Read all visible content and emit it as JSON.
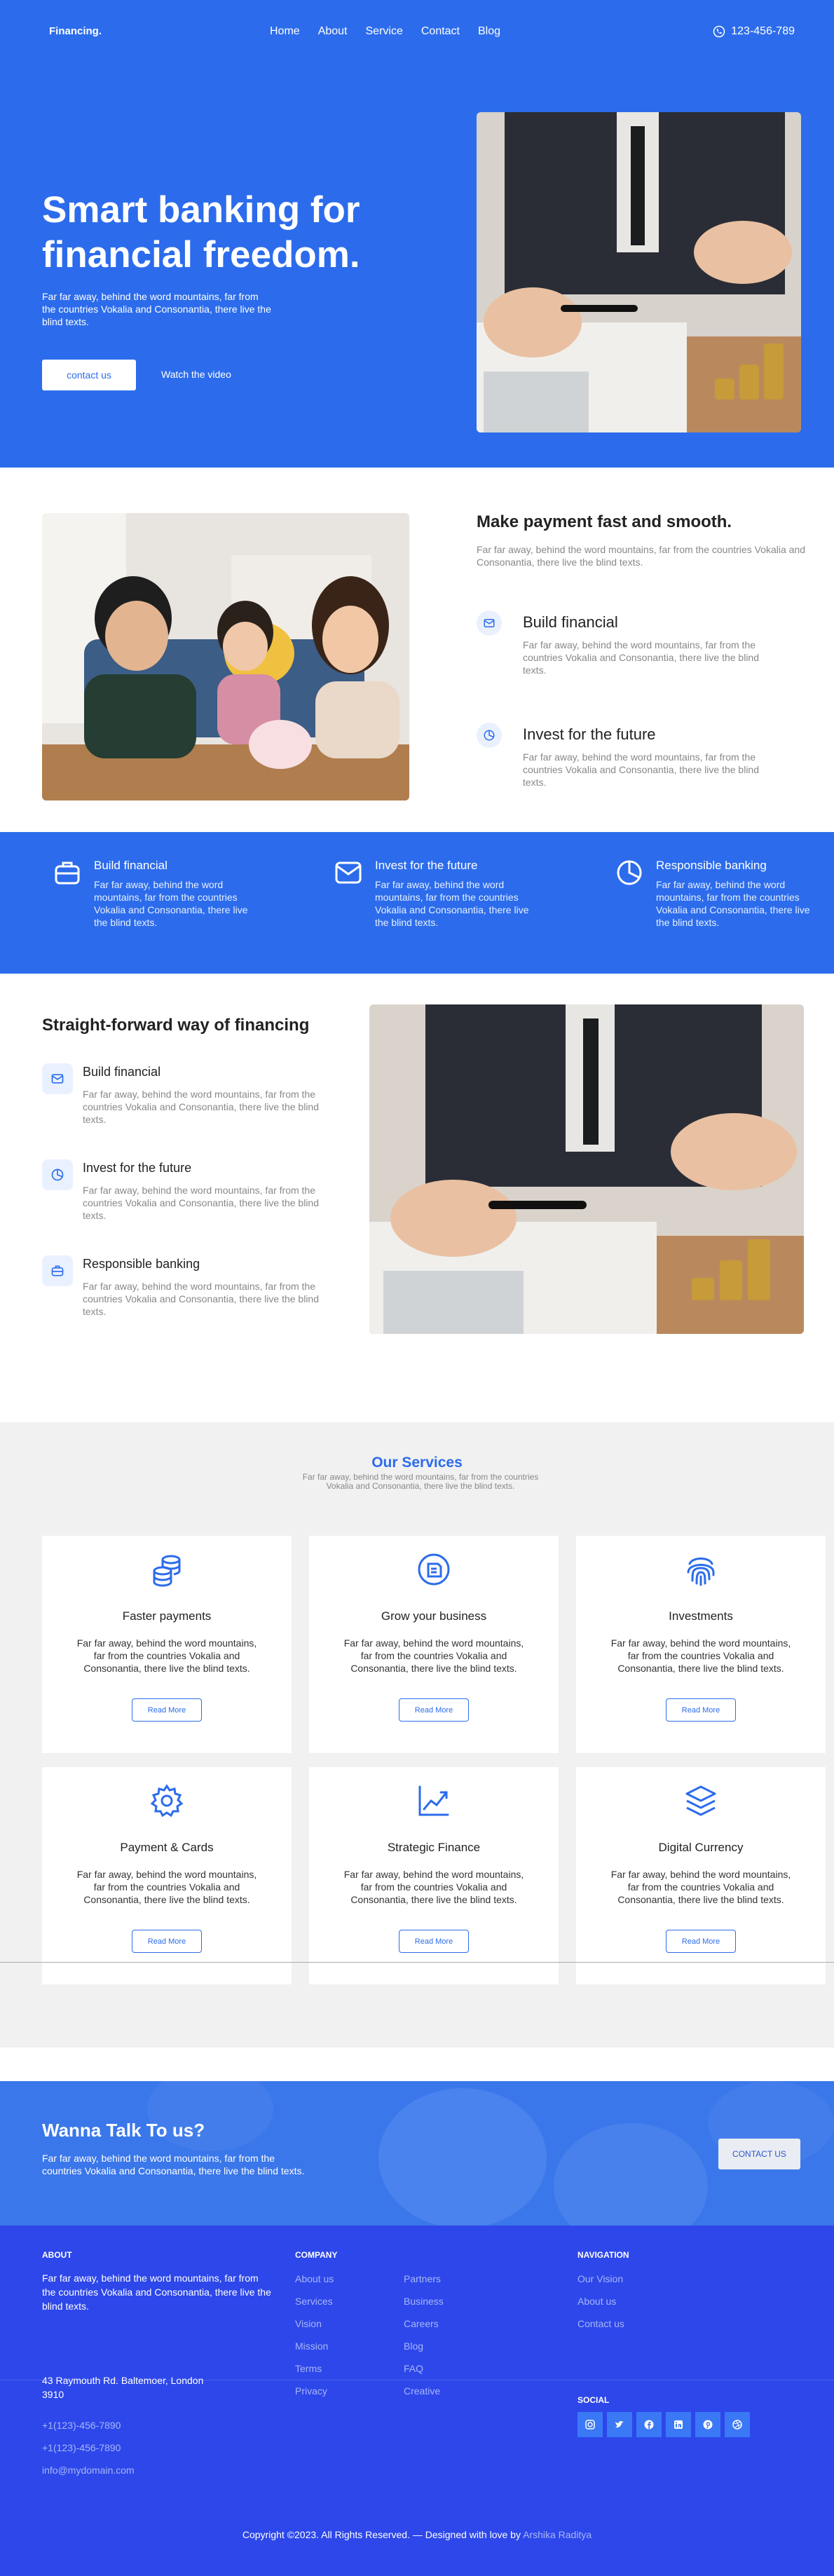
{
  "nav": {
    "brand": "Financing.",
    "items": [
      "Home",
      "About",
      "Service",
      "Contact",
      "Blog"
    ],
    "phone": "123-456-789"
  },
  "hero": {
    "title": "Smart banking for financial freedom.",
    "text": "Far far away, behind the word mountains, far from the countries Vokalia and Consonantia, there live the blind texts.",
    "cta_label": "contact us",
    "video_label": "Watch the video"
  },
  "payment": {
    "title": "Make payment fast and smooth.",
    "desc": "Far far away, behind the word mountains, far from the countries Vokalia and Consonantia, there live the blind texts.",
    "features": [
      {
        "icon": "envelope-icon",
        "title": "Build financial",
        "desc": "Far far away, behind the word mountains, far from the countries Vokalia and Consonantia, there live the blind texts."
      },
      {
        "icon": "pie-chart-icon",
        "title": "Invest for the future",
        "desc": "Far far away, behind the word mountains, far from the countries Vokalia and Consonantia, there live the blind texts."
      }
    ]
  },
  "band": {
    "items": [
      {
        "icon": "briefcase-icon",
        "title": "Build financial",
        "desc": "Far far away, behind the word mountains, far from the countries Vokalia and Consonantia, there live the blind texts."
      },
      {
        "icon": "envelope-icon",
        "title": "Invest for the future",
        "desc": "Far far away, behind the word mountains, far from the countries Vokalia and Consonantia, there live the blind texts."
      },
      {
        "icon": "pie-chart-icon",
        "title": "Responsible banking",
        "desc": "Far far away, behind the word mountains, far from the countries Vokalia and Consonantia, there live the blind texts."
      }
    ]
  },
  "straight": {
    "title": "Straight-forward way of financing",
    "items": [
      {
        "icon": "envelope-icon",
        "title": "Build financial",
        "desc": "Far far away, behind the word mountains, far from the countries Vokalia and Consonantia, there live the blind texts."
      },
      {
        "icon": "pie-chart-icon",
        "title": "Invest for the future",
        "desc": "Far far away, behind the word mountains, far from the countries Vokalia and Consonantia, there live the blind texts."
      },
      {
        "icon": "briefcase-icon",
        "title": "Responsible banking",
        "desc": "Far far away, behind the word mountains, far from the countries Vokalia and Consonantia, there live the blind texts."
      }
    ]
  },
  "services": {
    "heading": "Our Services",
    "sub": "Far far away, behind the word mountains, far from the countries Vokalia and Consonantia, there live the blind texts.",
    "cards": [
      {
        "icon": "coins-icon",
        "title": "Faster payments",
        "desc": "Far far away, behind the word mountains, far from the countries Vokalia and Consonantia, there live the blind texts.",
        "button": "Read More"
      },
      {
        "icon": "document-icon",
        "title": "Grow your business",
        "desc": "Far far away, behind the word mountains, far from the countries Vokalia and Consonantia, there live the blind texts.",
        "button": "Read More"
      },
      {
        "icon": "fingerprint-icon",
        "title": "Investments",
        "desc": "Far far away, behind the word mountains, far from the countries Vokalia and Consonantia, there live the blind texts.",
        "button": "Read More"
      },
      {
        "icon": "gear-icon",
        "title": "Payment & Cards",
        "desc": "Far far away, behind the word mountains, far from the countries Vokalia and Consonantia, there live the blind texts.",
        "button": "Read More"
      },
      {
        "icon": "chart-up-icon",
        "title": "Strategic Finance",
        "desc": "Far far away, behind the word mountains, far from the countries Vokalia and Consonantia, there live the blind texts.",
        "button": "Read More"
      },
      {
        "icon": "layers-icon",
        "title": "Digital Currency",
        "desc": "Far far away, behind the word mountains, far from the countries Vokalia and Consonantia, there live the blind texts.",
        "button": "Read More"
      }
    ]
  },
  "cta": {
    "title": "Wanna Talk To us?",
    "text": "Far far away, behind the word mountains, far from the countries Vokalia and Consonantia, there live the blind texts.",
    "button": "CONTACT US"
  },
  "footer": {
    "about_heading": "ABOUT",
    "about_text": "Far far away, behind the word mountains, far from the countries Vokalia and Consonantia, there live the blind texts.",
    "address": "43 Raymouth Rd. Baltemoer, London 3910",
    "phone1": "+1(123)-456-7890",
    "phone2": "+1(123)-456-7890",
    "email": "info@mydomain.com",
    "company_heading": "COMPANY",
    "company_col1": [
      "About us",
      "Services",
      "Vision",
      "Mission",
      "Terms",
      "Privacy"
    ],
    "company_col2": [
      "Partners",
      "Business",
      "Careers",
      "Blog",
      "FAQ",
      "Creative"
    ],
    "navigation_heading": "NAVIGATION",
    "navigation_links": [
      "Our Vision",
      "About us",
      "Contact us"
    ],
    "social_heading": "SOCIAL",
    "social_icons": [
      "instagram-icon",
      "twitter-icon",
      "facebook-icon",
      "linkedin-icon",
      "pinterest-icon",
      "dribbble-icon"
    ],
    "copyright": "Copyright ©2023. All Rights Reserved. — Designed with love by",
    "author": "Arshika Raditya"
  },
  "colors": {
    "primary": "#2c6cec",
    "footer": "#2d47ea",
    "muted": "#888888"
  }
}
